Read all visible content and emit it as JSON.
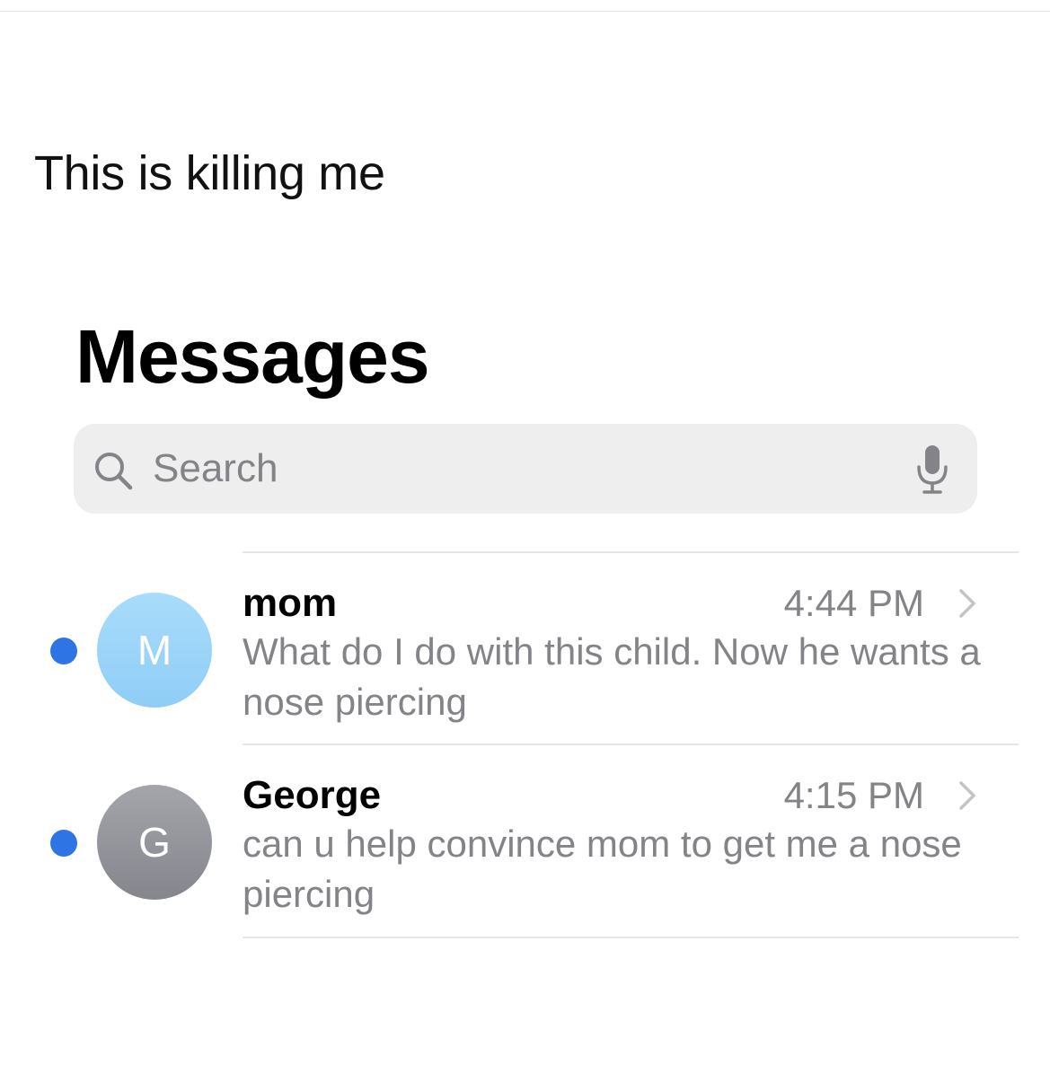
{
  "post": {
    "caption": "This is killing me"
  },
  "app": {
    "title": "Messages",
    "search": {
      "placeholder": "Search",
      "icon": "magnifying-glass",
      "mic_icon": "microphone"
    }
  },
  "conversations": [
    {
      "name": "mom",
      "initial": "M",
      "avatar_color": "#9ed5f9",
      "time": "4:44 PM",
      "preview": "What do I do with this child. Now he wants a nose piercing",
      "unread": true
    },
    {
      "name": "George",
      "initial": "G",
      "avatar_color": "#95969c",
      "time": "4:15 PM",
      "preview": "can u help convince mom to get me a nose piercing",
      "unread": true
    }
  ],
  "colors": {
    "unread_dot": "#2f74e4",
    "secondary_text": "#838388",
    "search_bg": "#eeeeef"
  }
}
